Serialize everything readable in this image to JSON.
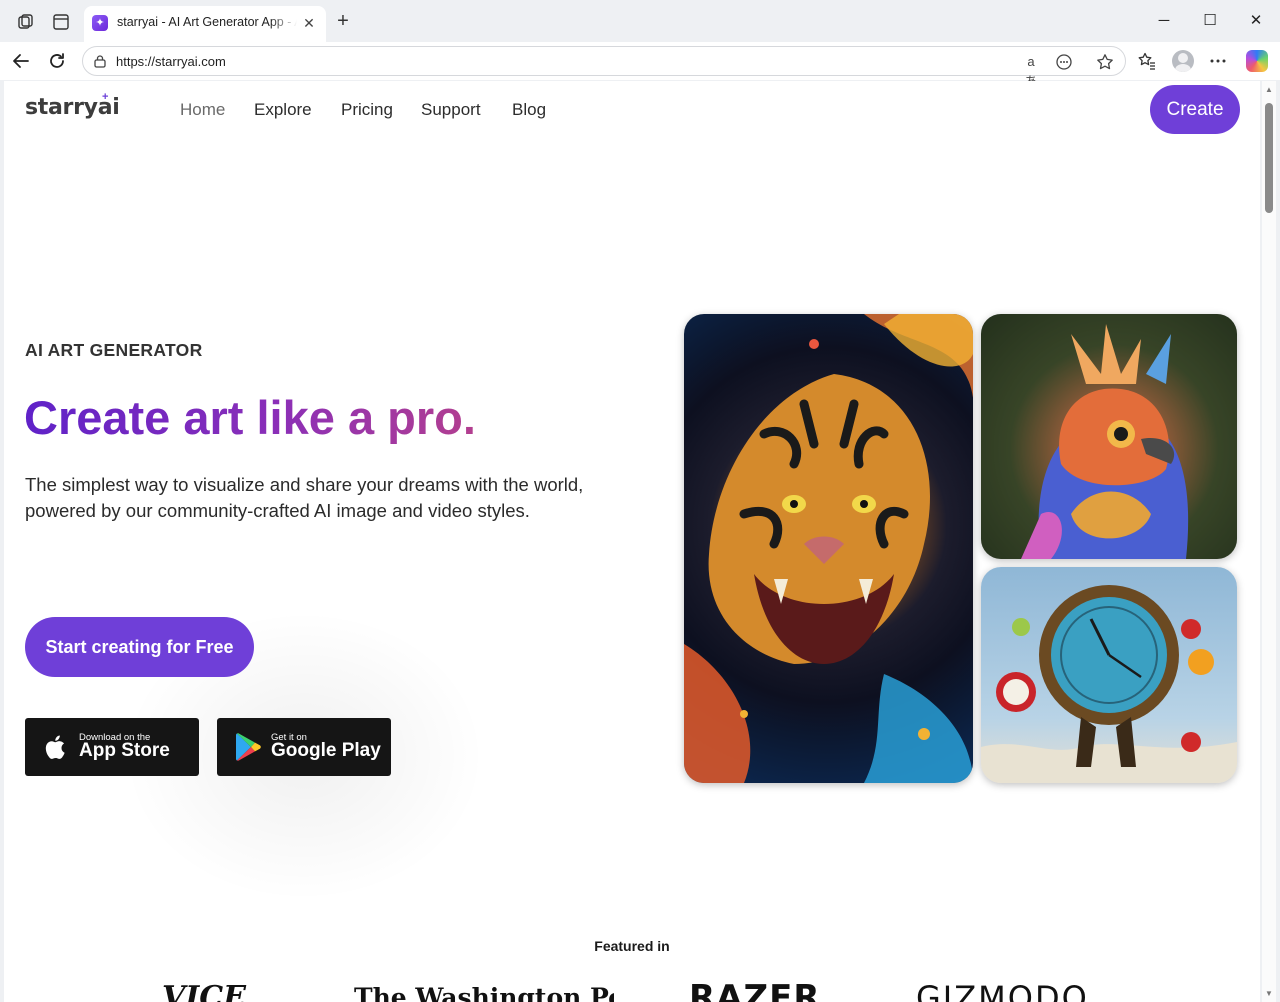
{
  "browser": {
    "tab_title": "starryai - AI Art Generator App - AI",
    "tab_favicon": "✦",
    "tab_close": "✕",
    "new_tab": "+",
    "url": "https://starryai.com",
    "read_aloud": "aあ",
    "window_minimize": "─",
    "window_maximize": "☐",
    "window_close": "✕"
  },
  "site": {
    "logo": "starryai",
    "logo_star": "+",
    "nav": [
      {
        "label": "Home",
        "active": true
      },
      {
        "label": "Explore"
      },
      {
        "label": "Pricing"
      },
      {
        "label": "Support"
      },
      {
        "label": "Blog"
      }
    ],
    "create_label": "Create",
    "accent": "#6f3fd8"
  },
  "hero": {
    "eyebrow": "AI ART GENERATOR",
    "headline": "Create art like a pro.",
    "subtitle": "The simplest way to visualize and share your dreams with the world, powered by our community-crafted AI image and video styles.",
    "cta_label": "Start creating for Free",
    "app_store": {
      "small": "Download on the",
      "big": "App Store",
      "icon": "apple-icon"
    },
    "google_play": {
      "small": "Get it on",
      "big": "Google Play",
      "icon": "google-play-icon"
    }
  },
  "featured": {
    "label": "Featured in",
    "logos": [
      "VICE",
      "The Washington Post",
      "RAZER",
      "GIZMODO"
    ]
  }
}
